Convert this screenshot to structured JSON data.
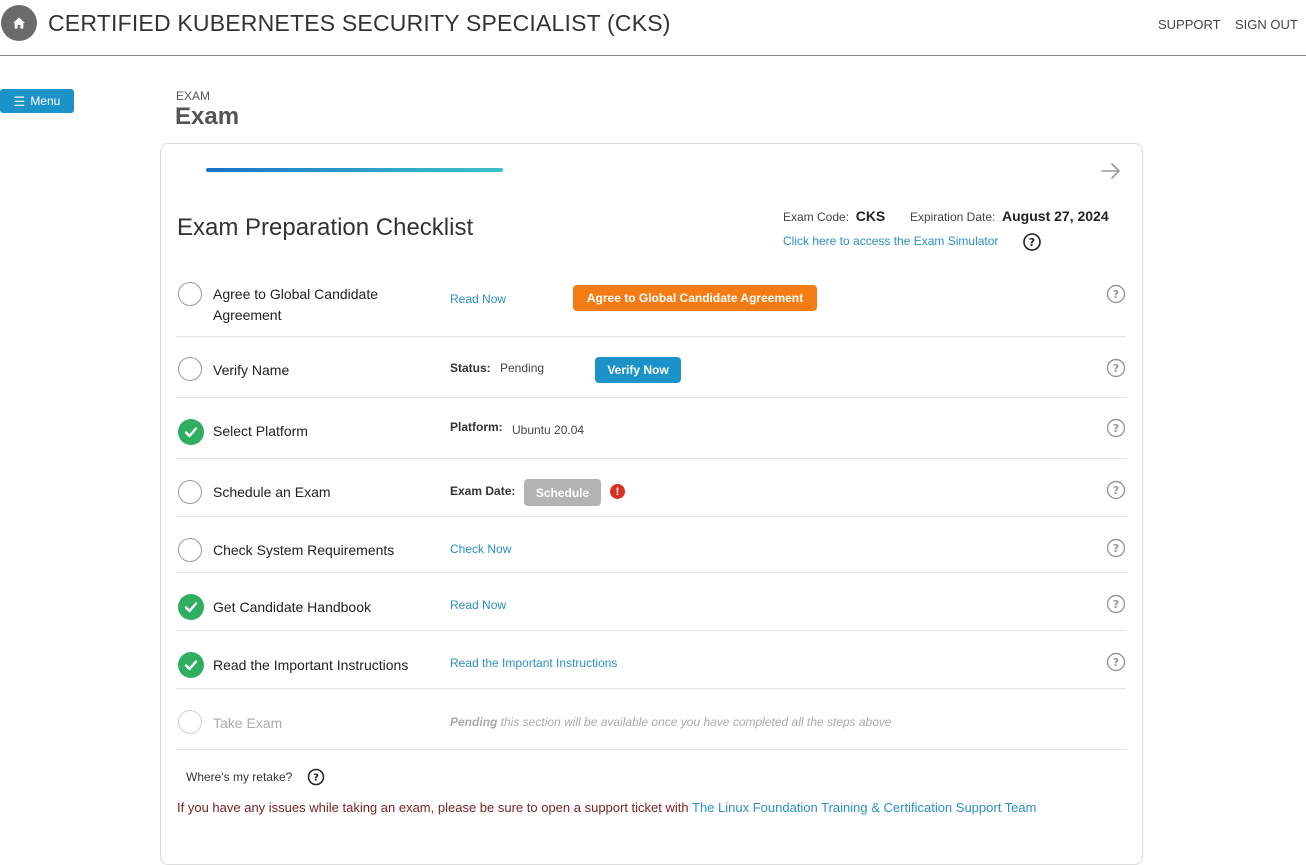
{
  "header": {
    "title": "CERTIFIED KUBERNETES SECURITY SPECIALIST (CKS)",
    "support_label": "SUPPORT",
    "signout_label": "SIGN OUT",
    "home_icon": "home-icon"
  },
  "menu": {
    "label": "Menu",
    "icon": "hamburger-icon"
  },
  "breadcrumb": "EXAM",
  "page_title": "Exam",
  "card": {
    "checklist_title": "Exam Preparation Checklist",
    "exam_code_label": "Exam Code:",
    "exam_code": "CKS",
    "expiration_label": "Expiration Date:",
    "expiration_date": "August 27, 2024",
    "simulator_link": "Click here to access the Exam Simulator"
  },
  "checklist": [
    {
      "label": "Agree to Global Candidate Agreement",
      "completed": false,
      "link": "Read Now",
      "button": "Agree to Global Candidate Agreement"
    },
    {
      "label": "Verify Name",
      "completed": false,
      "field_label": "Status:",
      "field_value": "Pending",
      "button": "Verify Now"
    },
    {
      "label": "Select Platform",
      "completed": true,
      "field_label": "Platform:",
      "field_value": "Ubuntu 20.04"
    },
    {
      "label": "Schedule an Exam",
      "completed": false,
      "field_label": "Exam Date:",
      "button": "Schedule",
      "alert": "!"
    },
    {
      "label": "Check System Requirements",
      "completed": false,
      "link": "Check Now"
    },
    {
      "label": "Get Candidate Handbook",
      "completed": true,
      "link": "Read Now"
    },
    {
      "label": "Read the Important Instructions",
      "completed": true,
      "link": "Read the Important Instructions"
    },
    {
      "label": "Take Exam",
      "completed": false,
      "disabled": true,
      "pending_word": "Pending",
      "pending_note": " this section will be available once you have completed all the steps above"
    }
  ],
  "footer": {
    "retake": "Where's my retake?",
    "issues_text": "If you have any issues while taking an exam, please be sure to open a support ticket with ",
    "issues_link": "The Linux Foundation Training & Certification Support Team"
  },
  "colors": {
    "accent_blue": "#1b93c9",
    "orange": "#f57c14",
    "success_green": "#2fad61",
    "alert_red": "#d93025",
    "link_blue": "#2a8fc7"
  }
}
